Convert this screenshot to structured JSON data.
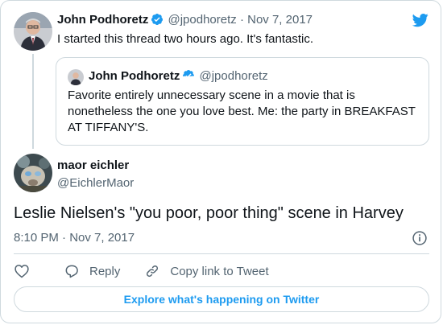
{
  "brand": {
    "icon": "twitter-bird-icon",
    "color": "#1d9bf0"
  },
  "parent_tweet": {
    "name": "John Podhoretz",
    "handle": "@jpodhoretz",
    "separator": "·",
    "date": "Nov 7, 2017",
    "text": "I started this thread two hours ago. It's fantastic."
  },
  "quoted_tweet": {
    "name": "John Podhoretz",
    "handle": "@jpodhoretz",
    "text": "Favorite entirely unnecessary scene in a movie that is nonetheless the one you love best. Me: the party in BREAKFAST AT TIFFANY'S."
  },
  "main_tweet": {
    "name": "maor eichler",
    "handle": "@EichlerMaor",
    "text": "Leslie Nielsen's \"you poor, poor thing\" scene in Harvey",
    "timestamp": "8:10 PM · Nov 7, 2017"
  },
  "actions": {
    "like_icon": "heart-icon",
    "reply_label": "Reply",
    "copy_link_label": "Copy link to Tweet"
  },
  "explore": {
    "label": "Explore what's happening on Twitter"
  },
  "colors": {
    "accent": "#1d9bf0",
    "text": "#0f1419",
    "secondary": "#536471",
    "border": "#cfd9de"
  }
}
